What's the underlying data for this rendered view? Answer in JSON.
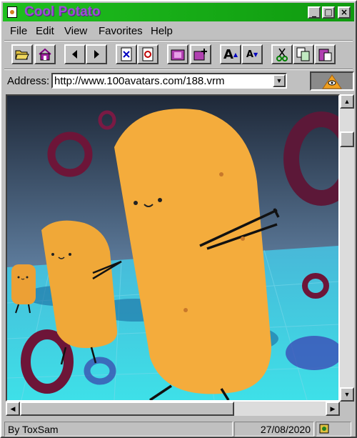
{
  "window": {
    "title": "Cool Potato"
  },
  "window_controls": {
    "minimize": "_",
    "maximize": "□",
    "close": "×"
  },
  "menu": [
    "File",
    "Edit",
    "View",
    "Favorites",
    "Help"
  ],
  "toolbar": {
    "buttons": [
      "open-folder-icon",
      "home-icon",
      "back-icon",
      "forward-icon",
      "stop-icon",
      "refresh-icon",
      "history-icon",
      "favorites-icon",
      "font-larger-icon",
      "font-smaller-icon",
      "cut-icon",
      "copy-icon",
      "paste-icon"
    ],
    "font_larger": "A",
    "font_smaller": "A"
  },
  "address": {
    "label": "Address:",
    "url": "http://www.100avatars.com/188.vrm"
  },
  "content": {
    "image": "three orange potato characters with stick arms walking on a cyan tiled floor among purple ring shapes"
  },
  "status": {
    "author": "By ToxSam",
    "date": "27/08/2020"
  },
  "colors": {
    "titlebar": "#1fbf1f",
    "title_text": "#9b4fd6",
    "chrome": "#c0c0c0",
    "floor": "#4cc9d8",
    "potato": "#f2a93a",
    "ring": "#6d1538"
  }
}
